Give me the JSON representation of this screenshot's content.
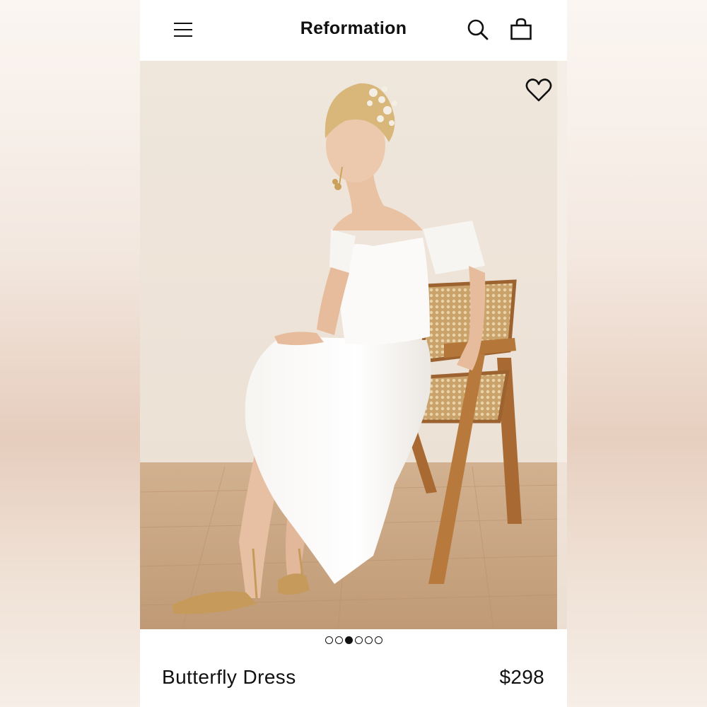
{
  "header": {
    "brand": "Reformation",
    "menu_icon": "hamburger-menu-icon",
    "search_icon": "search-icon",
    "bag_icon": "shopping-bag-icon"
  },
  "gallery": {
    "favorite_icon": "heart-icon",
    "image_description_icon": "product-photo",
    "total_images": 6,
    "active_index": 2
  },
  "product": {
    "name": "Butterfly Dress",
    "price": "$298"
  },
  "colors": {
    "text": "#111111",
    "background": "#ffffff"
  }
}
